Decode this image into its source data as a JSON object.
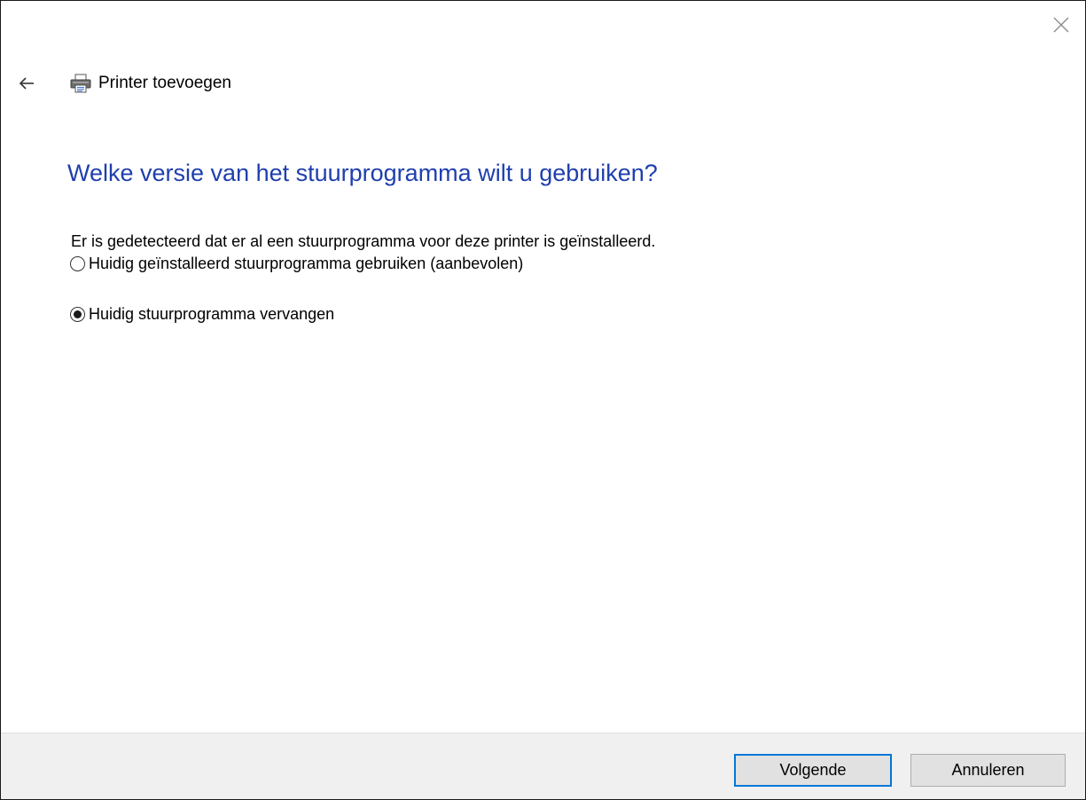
{
  "header": {
    "title": "Printer toevoegen"
  },
  "main": {
    "heading": "Welke versie van het stuurprogramma wilt u gebruiken?",
    "description": "Er is gedetecteerd dat er al een stuurprogramma voor deze printer is geïnstalleerd.",
    "options": [
      {
        "label": "Huidig geïnstalleerd stuurprogramma gebruiken (aanbevolen)",
        "selected": false
      },
      {
        "label": "Huidig stuurprogramma vervangen",
        "selected": true
      }
    ]
  },
  "footer": {
    "next_label": "Volgende",
    "cancel_label": "Annuleren"
  },
  "colors": {
    "heading": "#1f3fad",
    "default_button_border": "#0078d7",
    "footer_background": "#f0f0f0"
  },
  "icons": {
    "close": "close-icon",
    "back": "back-arrow-icon",
    "printer": "printer-icon"
  }
}
